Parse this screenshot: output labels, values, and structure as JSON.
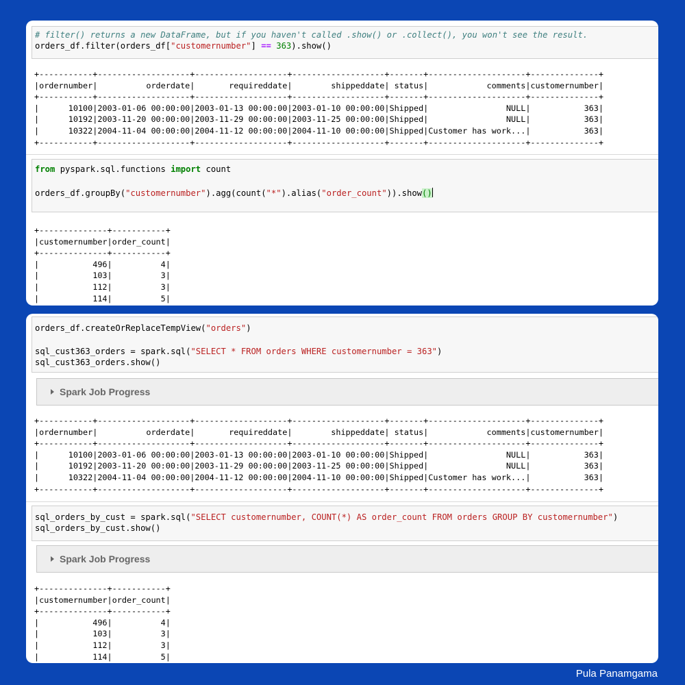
{
  "panel1": {
    "cell1": {
      "comment": "# filter() returns a new DataFrame, but if you haven't called .show() or .collect(), you won't see the result.",
      "line2": {
        "a": "orders_df.filter(orders_df[",
        "str": "\"customernumber\"",
        "b": "] ",
        "op": "==",
        "c": " ",
        "num": "363",
        "d": ").show()"
      },
      "output": "+-----------+-------------------+-------------------+-------------------+-------+--------------------+--------------+\n|ordernumber|          orderdate|       requireddate|        shippeddate| status|            comments|customernumber|\n+-----------+-------------------+-------------------+-------------------+-------+--------------------+--------------+\n|      10100|2003-01-06 00:00:00|2003-01-13 00:00:00|2003-01-10 00:00:00|Shipped|                NULL|           363|\n|      10192|2003-11-20 00:00:00|2003-11-29 00:00:00|2003-11-25 00:00:00|Shipped|                NULL|           363|\n|      10322|2004-11-04 00:00:00|2004-11-12 00:00:00|2004-11-10 00:00:00|Shipped|Customer has work...|           363|\n+-----------+-------------------+-------------------+-------------------+-------+--------------------+--------------+"
    },
    "cell2": {
      "line1": {
        "kw1": "from",
        "a": " pyspark.sql.functions ",
        "kw2": "import",
        "b": " count"
      },
      "line2": {
        "a": "orders_df.groupBy(",
        "str1": "\"customernumber\"",
        "b": ").agg(count(",
        "str2": "\"*\"",
        "c": ").alias(",
        "str3": "\"order_count\"",
        "d": ")).show",
        "paren": "()"
      },
      "output": "+--------------+-----------+\n|customernumber|order_count|\n+--------------+-----------+\n|           496|          4|\n|           103|          3|\n|           112|          3|\n|           114|          5|"
    }
  },
  "panel2": {
    "cell3": {
      "line1": {
        "a": "orders_df.createOrReplaceTempView(",
        "str": "\"orders\"",
        "b": ")"
      },
      "line2": {
        "a": "sql_cust363_orders = spark.sql(",
        "str": "\"SELECT * FROM orders WHERE customernumber = 363\"",
        "b": ")"
      },
      "line3": "sql_cust363_orders.show()",
      "spark_progress": "Spark Job Progress",
      "output": "+-----------+-------------------+-------------------+-------------------+-------+--------------------+--------------+\n|ordernumber|          orderdate|       requireddate|        shippeddate| status|            comments|customernumber|\n+-----------+-------------------+-------------------+-------------------+-------+--------------------+--------------+\n|      10100|2003-01-06 00:00:00|2003-01-13 00:00:00|2003-01-10 00:00:00|Shipped|                NULL|           363|\n|      10192|2003-11-20 00:00:00|2003-11-29 00:00:00|2003-11-25 00:00:00|Shipped|                NULL|           363|\n|      10322|2004-11-04 00:00:00|2004-11-12 00:00:00|2004-11-10 00:00:00|Shipped|Customer has work...|           363|\n+-----------+-------------------+-------------------+-------------------+-------+--------------------+--------------+"
    },
    "cell4": {
      "line1": {
        "a": "sql_orders_by_cust = spark.sql(",
        "str": "\"SELECT customernumber, COUNT(*) AS order_count FROM orders GROUP BY customernumber\"",
        "b": ")"
      },
      "line2": "sql_orders_by_cust.show()",
      "spark_progress": "Spark Job Progress",
      "output": "+--------------+-----------+\n|customernumber|order_count|\n+--------------+-----------+\n|           496|          4|\n|           103|          3|\n|           112|          3|\n|           114|          5|"
    }
  },
  "signature": "Pula Panamgama"
}
